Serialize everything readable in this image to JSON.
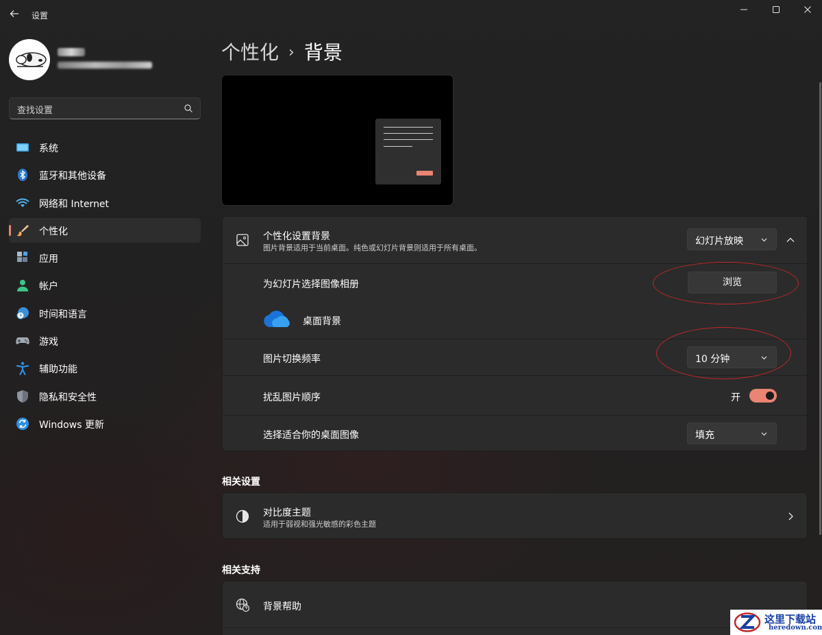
{
  "app": {
    "title": "设置"
  },
  "search": {
    "placeholder": "查找设置"
  },
  "sidebar": {
    "items": [
      {
        "label": "系统",
        "icon": "system-icon",
        "active": false
      },
      {
        "label": "蓝牙和其他设备",
        "icon": "bluetooth-icon",
        "active": false
      },
      {
        "label": "网络和 Internet",
        "icon": "wifi-icon",
        "active": false
      },
      {
        "label": "个性化",
        "icon": "paintbrush-icon",
        "active": true
      },
      {
        "label": "应用",
        "icon": "apps-icon",
        "active": false
      },
      {
        "label": "帐户",
        "icon": "account-icon",
        "active": false
      },
      {
        "label": "时间和语言",
        "icon": "time-language-icon",
        "active": false
      },
      {
        "label": "游戏",
        "icon": "gamepad-icon",
        "active": false
      },
      {
        "label": "辅助功能",
        "icon": "accessibility-icon",
        "active": false
      },
      {
        "label": "隐私和安全性",
        "icon": "shield-icon",
        "active": false
      },
      {
        "label": "Windows 更新",
        "icon": "update-icon",
        "active": false
      }
    ]
  },
  "breadcrumb": {
    "parent": "个性化",
    "separator": "›",
    "current": "背景"
  },
  "background_card": {
    "title": "个性化设置背景",
    "subtitle": "图片背景适用于当前桌面。纯色或幻灯片背景则适用于所有桌面。",
    "dropdown_value": "幻灯片放映",
    "album": {
      "label": "为幻灯片选择图像相册",
      "button": "浏览"
    },
    "folder": {
      "label": "桌面背景"
    },
    "frequency": {
      "label": "图片切换频率",
      "value": "10 分钟"
    },
    "shuffle": {
      "label": "扰乱图片顺序",
      "state": "开",
      "on": true
    },
    "fit": {
      "label": "选择适合你的桌面图像",
      "value": "填充"
    }
  },
  "related_settings": {
    "heading": "相关设置",
    "contrast": {
      "title": "对比度主题",
      "subtitle": "适用于弱视和强光敏感的彩色主题"
    }
  },
  "related_support": {
    "heading": "相关支持",
    "help": {
      "title": "背景帮助"
    }
  },
  "watermark": {
    "title": "这里下载站",
    "url": "heredown.com"
  },
  "colors": {
    "accent": "#e98572",
    "background": "#202020",
    "card": "#2b2b2b",
    "annotation": "#c0282a"
  }
}
